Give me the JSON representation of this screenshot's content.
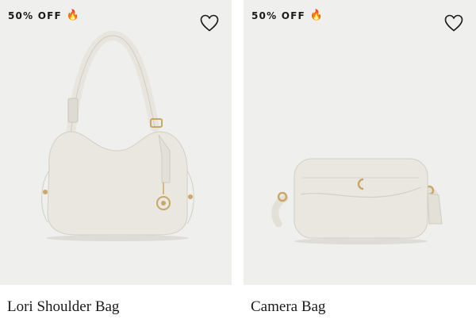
{
  "products": [
    {
      "badge_text": "50% OFF",
      "badge_icon": "fire-emoji",
      "title": "Lori Shoulder Bag",
      "wishlist_icon": "heart-outline-icon"
    },
    {
      "badge_text": "50% OFF",
      "badge_icon": "fire-emoji",
      "title": "Camera Bag",
      "wishlist_icon": "heart-outline-icon"
    }
  ],
  "colors": {
    "image_background": "#efefee",
    "bag_leather": "#e9e7e0",
    "hardware_gold": "#c9a867",
    "text": "#1a1a1a"
  }
}
